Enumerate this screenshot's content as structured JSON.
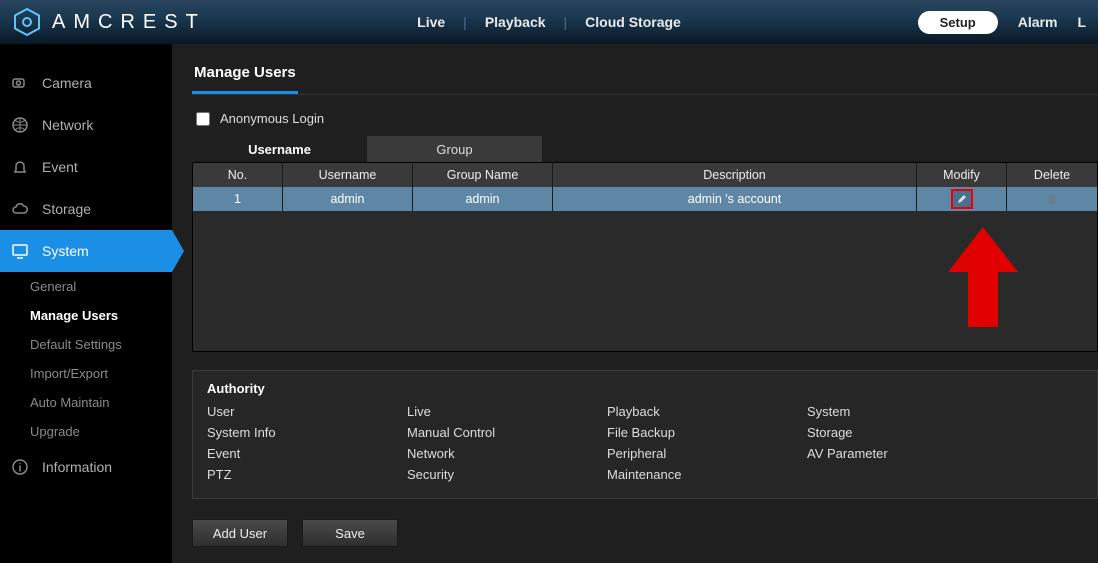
{
  "brand": "AMCREST",
  "topnav": {
    "live": "Live",
    "playback": "Playback",
    "cloud": "Cloud Storage"
  },
  "topright": {
    "setup": "Setup",
    "alarm": "Alarm",
    "extra": "L"
  },
  "sidebar": {
    "items": [
      {
        "id": "camera",
        "label": "Camera"
      },
      {
        "id": "network",
        "label": "Network"
      },
      {
        "id": "event",
        "label": "Event"
      },
      {
        "id": "storage",
        "label": "Storage"
      },
      {
        "id": "system",
        "label": "System"
      },
      {
        "id": "information",
        "label": "Information"
      }
    ],
    "system_sub": [
      {
        "id": "general",
        "label": "General"
      },
      {
        "id": "manage-users",
        "label": "Manage Users"
      },
      {
        "id": "default-settings",
        "label": "Default Settings"
      },
      {
        "id": "import-export",
        "label": "Import/Export"
      },
      {
        "id": "auto-maintain",
        "label": "Auto Maintain"
      },
      {
        "id": "upgrade",
        "label": "Upgrade"
      }
    ]
  },
  "page": {
    "title": "Manage Users",
    "anonymous_label": "Anonymous Login",
    "anonymous_checked": false,
    "subtabs": {
      "username": "Username",
      "group": "Group"
    },
    "columns": {
      "no": "No.",
      "username": "Username",
      "group": "Group Name",
      "description": "Description",
      "modify": "Modify",
      "delete": "Delete"
    },
    "rows": [
      {
        "no": "1",
        "username": "admin",
        "group": "admin",
        "description": "admin 's account"
      }
    ],
    "authority": {
      "title": "Authority",
      "items": [
        "User",
        "Live",
        "Playback",
        "System",
        "System Info",
        "Manual Control",
        "File Backup",
        "Storage",
        "Event",
        "Network",
        "Peripheral",
        "AV Parameter",
        "PTZ",
        "Security",
        "Maintenance",
        ""
      ]
    },
    "buttons": {
      "add_user": "Add User",
      "save": "Save"
    }
  }
}
